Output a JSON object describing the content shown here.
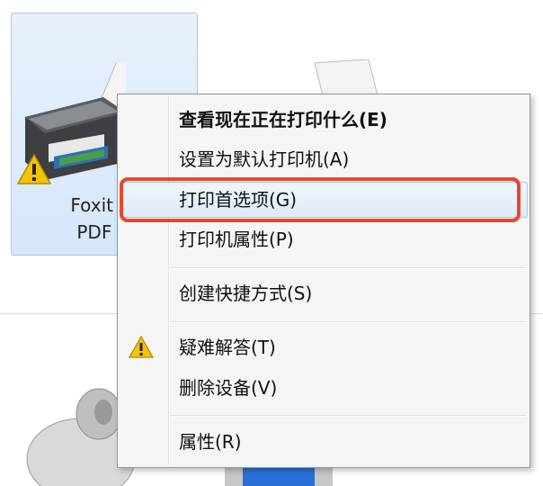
{
  "devices": {
    "selected_device_caption_line1": "Foxit Re",
    "selected_device_caption_line2": "PDF Pr",
    "selected_device_icon": "printer-icon",
    "selected_device_badge": "warning-icon",
    "other_device_icon": "printer-icon",
    "bottom_device_icon": "mouse-icon"
  },
  "context_menu": {
    "items": [
      {
        "label": "查看现在正在打印什么(E)",
        "bold": true,
        "icon": null
      },
      {
        "label": "设置为默认打印机(A)",
        "bold": false,
        "icon": null
      },
      {
        "label": "打印首选项(G)",
        "bold": false,
        "icon": null,
        "highlighted": true
      },
      {
        "label": "打印机属性(P)",
        "bold": false,
        "icon": null
      },
      {
        "label": "创建快捷方式(S)",
        "bold": false,
        "icon": null
      },
      {
        "label": "疑难解答(T)",
        "bold": false,
        "icon": "warning-icon"
      },
      {
        "label": "删除设备(V)",
        "bold": false,
        "icon": null
      },
      {
        "label": "属性(R)",
        "bold": false,
        "icon": null
      }
    ]
  },
  "colors": {
    "highlight_annotation": "#e8472c",
    "selection_border": "#a9c9ee",
    "menu_background": "#f5f5f5"
  }
}
